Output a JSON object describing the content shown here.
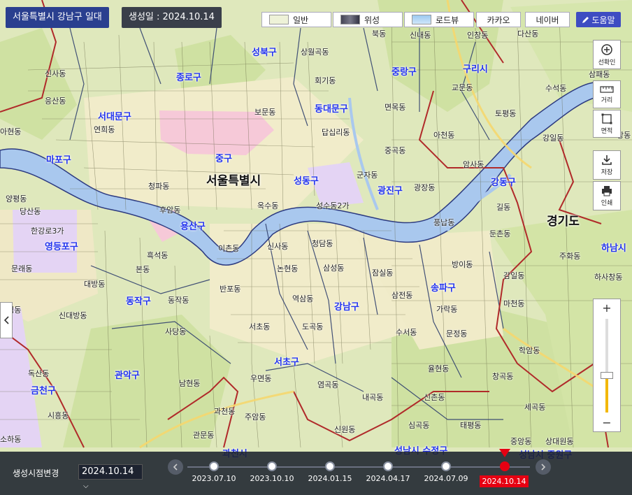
{
  "header": {
    "title": "서울특별시 강남구 일대",
    "created": "생성일 : 2024.10.14"
  },
  "map_types": [
    {
      "label": "일반",
      "icon": "general-map-icon"
    },
    {
      "label": "위성",
      "icon": "satellite-map-icon"
    },
    {
      "label": "로드뷰",
      "icon": "roadview-map-icon"
    },
    {
      "label": "카카오"
    },
    {
      "label": "네이버"
    }
  ],
  "help": {
    "label": "도움말",
    "icon": "pencil-icon"
  },
  "tools": {
    "selection": "선확인",
    "distance": "거리",
    "area": "면적",
    "save": "저장",
    "print": "인쇄"
  },
  "zoom": {
    "plus": "+",
    "minus": "−",
    "level": 0.38
  },
  "map": {
    "regions": {
      "seoul": "서울특별시",
      "gyeonggi": "경기도"
    },
    "gu": [
      {
        "name": "성북구"
      },
      {
        "name": "종로구"
      },
      {
        "name": "중랑구"
      },
      {
        "name": "구리시"
      },
      {
        "name": "서대문구"
      },
      {
        "name": "동대문구"
      },
      {
        "name": "마포구"
      },
      {
        "name": "중구"
      },
      {
        "name": "성동구"
      },
      {
        "name": "광진구"
      },
      {
        "name": "강동구"
      },
      {
        "name": "용산구"
      },
      {
        "name": "영등포구"
      },
      {
        "name": "하남시"
      },
      {
        "name": "송파구"
      },
      {
        "name": "동작구"
      },
      {
        "name": "강남구"
      },
      {
        "name": "서초구"
      },
      {
        "name": "관악구"
      },
      {
        "name": "금천구"
      },
      {
        "name": "과천시"
      },
      {
        "name": "성남시 수정구"
      },
      {
        "name": "성남시 중원구"
      }
    ],
    "dong": [
      "북동",
      "신내동",
      "인창동",
      "다산동",
      "상월곡동",
      "신사동",
      "회기동",
      "교문동",
      "수석동",
      "삼패동",
      "응산동",
      "면목동",
      "토평동",
      "아현동",
      "연희동",
      "보문동",
      "답십리동",
      "아천동",
      "강일동",
      "창동",
      "중곡동",
      "암사동",
      "군자동",
      "광장동",
      "길동",
      "양평동",
      "풍납동",
      "둔촌동",
      "옥수동",
      "성수동2가",
      "청담동",
      "신사동",
      "방이동",
      "문래동",
      "본동",
      "삼성동",
      "논현동",
      "잠실동",
      "감일동",
      "흑석동",
      "대방동",
      "반포동",
      "역삼동",
      "삼전동",
      "가락동",
      "마천동",
      "하사창동",
      "동작동",
      "사당동",
      "도곡동",
      "서초동",
      "수서동",
      "문정동",
      "학암동",
      "대림동",
      "신대방동",
      "남현동",
      "우면동",
      "염곡동",
      "율현동",
      "창곡동",
      "독산동",
      "시흥동",
      "과천동",
      "내곡동",
      "신촌동",
      "주암동",
      "신원동",
      "심곡동",
      "태평동",
      "소하동",
      "관문동",
      "중앙동",
      "상대원동",
      "청파동",
      "후암동",
      "당산동",
      "한강로3가",
      "이촌동",
      "주화동",
      "세곡동"
    ]
  },
  "timeline": {
    "label": "생성시점변경",
    "selected": "2024.10.14",
    "dates": [
      {
        "date": "2023.07.10",
        "active": false
      },
      {
        "date": "2023.10.10",
        "active": false
      },
      {
        "date": "2024.01.15",
        "active": false
      },
      {
        "date": "2024.04.17",
        "active": false
      },
      {
        "date": "2024.07.09",
        "active": false
      },
      {
        "date": "2024.10.14",
        "active": true
      }
    ]
  },
  "colors": {
    "river": "#a9c8ee",
    "land": "#dfe9c0",
    "urban": "#f3efc8",
    "pink_zone": "#f6c9d8",
    "purple_zone": "#e0cdf3",
    "boundary_red": "#b02a2a",
    "boundary_blue": "#2c3a80",
    "accent_red": "#e60012",
    "title_blue": "#2a3f8f"
  }
}
